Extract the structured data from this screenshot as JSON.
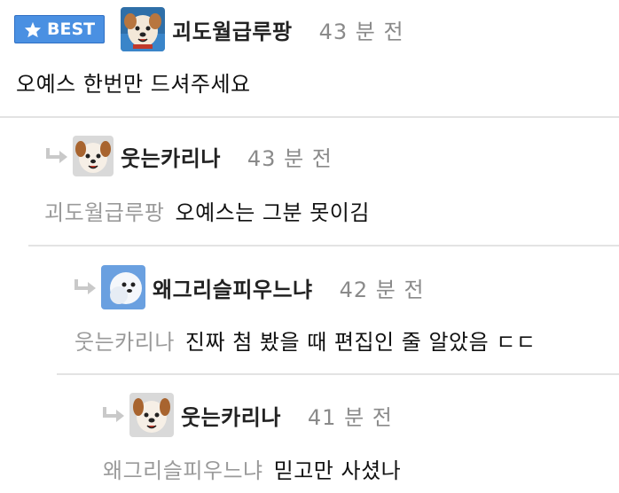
{
  "comments": [
    {
      "best_label": "BEST",
      "nickname": "괴도월급루팡",
      "time": "43 분 전",
      "text": "오예스 한번만 드셔주세요"
    },
    {
      "nickname": "웃는카리나",
      "time": "43 분 전",
      "mention": "괴도월급루팡",
      "text": "오예스는 그분 못이김"
    },
    {
      "nickname": "왜그리슬피우느냐",
      "time": "42 분 전",
      "mention": "웃는카리나",
      "text": "진짜 첨 봤을 때 편집인 줄 알았음 ㄷㄷ"
    },
    {
      "nickname": "웃는카리나",
      "time": "41 분 전",
      "mention": "왜그리슬피우느냐",
      "text": "믿고만 사셨나"
    }
  ],
  "icons": {
    "best_star": "star-icon",
    "reply": "reply-arrow-icon"
  },
  "colors": {
    "best_badge": "#4a90e2",
    "mention": "#9a9a9a",
    "time": "#8a8a8a",
    "divider": "#e3e3e3"
  }
}
